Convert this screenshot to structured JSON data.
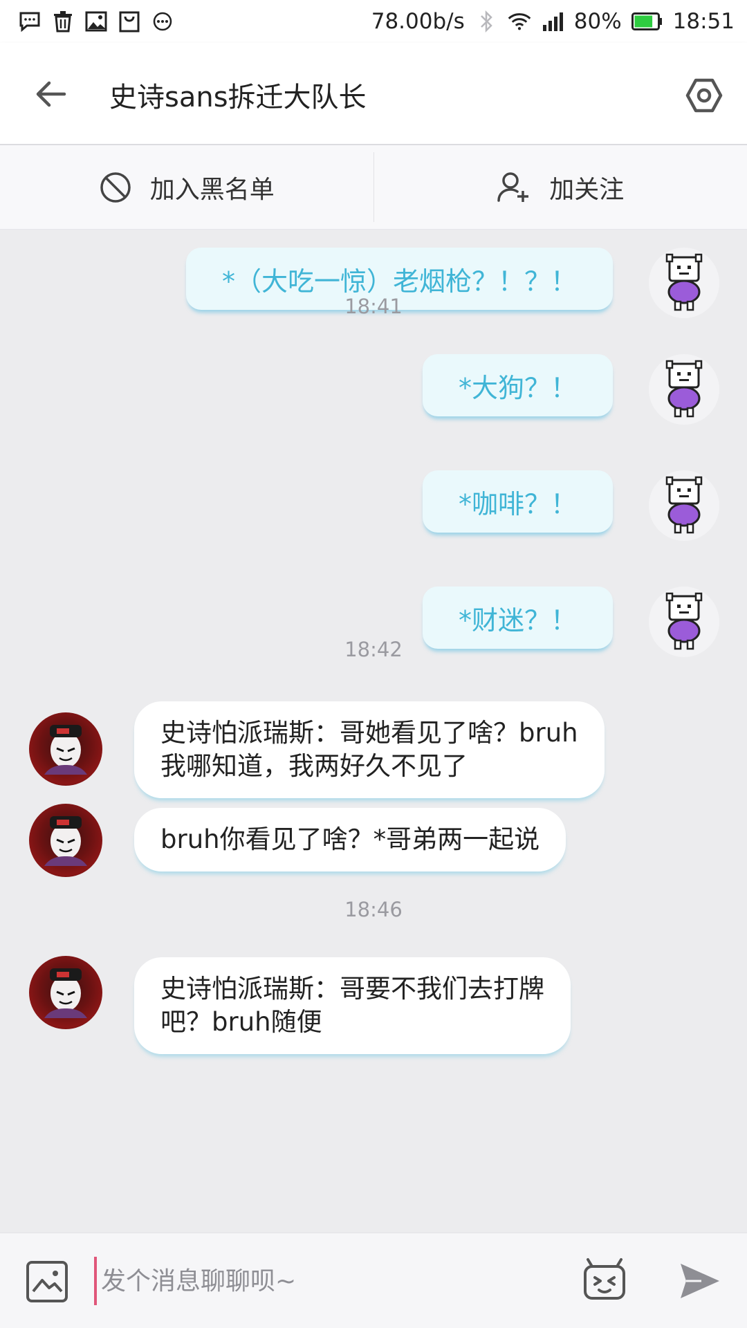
{
  "status_bar": {
    "left_icons": [
      "message-icon",
      "trash-icon",
      "image-icon",
      "shopping-bag-icon",
      "more-icon"
    ],
    "speed": "78.00b/s",
    "battery_percent": "80%",
    "battery_level": 0.8,
    "battery_color": "#2ecc40",
    "time": "18:51"
  },
  "header": {
    "back_icon": "arrow-left-icon",
    "title": "史诗sans拆迁大队长",
    "settings_icon": "hexagon-settings-icon"
  },
  "actions": {
    "blacklist_label": "加入黑名单",
    "blacklist_icon": "block-icon",
    "follow_label": "加关注",
    "follow_icon": "add-user-icon"
  },
  "colors": {
    "outgoing_text": "#40b5d6",
    "outgoing_bubble": "#eaf9fc",
    "background": "#ececee",
    "cursor": "#e0567a"
  },
  "messages": {
    "out_1": "*（大吃一惊）老烟枪？！？！",
    "time_1": "18:41",
    "out_2": "*大狗？！",
    "out_3": "*咖啡？！",
    "out_4": "*财迷？！",
    "time_2": "18:42",
    "in_1_line1": "史诗怕派瑞斯：哥她看见了啥？bruh",
    "in_1_line2": "我哪知道，我两好久不见了",
    "in_2": "bruh你看见了啥？*哥弟两一起说",
    "time_3": "18:46",
    "in_3_line1": "史诗怕派瑞斯：哥要不我们去打牌",
    "in_3_line2": "吧？bruh随便"
  },
  "input": {
    "placeholder": "发个消息聊聊呗~",
    "value": ""
  }
}
